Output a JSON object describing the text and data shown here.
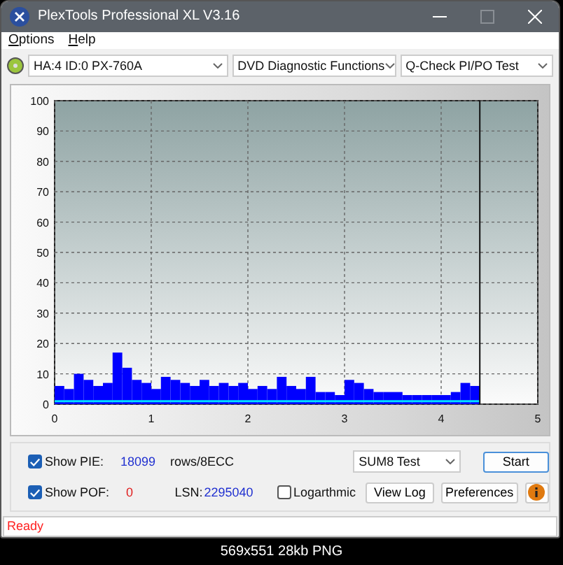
{
  "window": {
    "title": "PlexTools Professional XL V3.16"
  },
  "menu": [
    "Options",
    "Help"
  ],
  "toolbar": {
    "drive": "HA:4 ID:0  PX-760A",
    "function": "DVD Diagnostic Functions",
    "test": "Q-Check PI/PO Test"
  },
  "chart": {
    "chart_data": {
      "type": "bar",
      "xlim": [
        0,
        5
      ],
      "ylim": [
        0,
        100
      ],
      "xticks": [
        0,
        1,
        2,
        3,
        4,
        5
      ],
      "yticks": [
        0,
        10,
        20,
        30,
        40,
        50,
        60,
        70,
        80,
        90,
        100
      ],
      "x": [
        0.05,
        0.15,
        0.25,
        0.35,
        0.45,
        0.55,
        0.65,
        0.75,
        0.85,
        0.95,
        1.05,
        1.15,
        1.25,
        1.35,
        1.45,
        1.55,
        1.65,
        1.75,
        1.85,
        1.95,
        2.05,
        2.15,
        2.25,
        2.35,
        2.45,
        2.55,
        2.65,
        2.75,
        2.85,
        2.95,
        3.05,
        3.15,
        3.25,
        3.35,
        3.45,
        3.55,
        3.65,
        3.75,
        3.85,
        3.95,
        4.05,
        4.15,
        4.25,
        4.35
      ],
      "series": [
        {
          "color": "#0000ff",
          "values": [
            6,
            5,
            10,
            8,
            6,
            7,
            17,
            12,
            8,
            7,
            5,
            9,
            8,
            7,
            6,
            8,
            6,
            7,
            6,
            7,
            5,
            6,
            5,
            9,
            6,
            5,
            9,
            4,
            4,
            3,
            8,
            7,
            5,
            4,
            4,
            4,
            3,
            3,
            3,
            3,
            3,
            4,
            7,
            6
          ]
        }
      ],
      "grid": true,
      "ref_lines": [
        {
          "axis": "y",
          "value": 1,
          "color": "#00e0ff"
        },
        {
          "axis": "x",
          "value": 4.4,
          "color": "#111111"
        }
      ]
    }
  },
  "controls": {
    "show_pie": {
      "label": "Show PIE:",
      "checked": true,
      "value": "18099"
    },
    "unit": "rows/8ECC",
    "show_poe": {
      "label": "Show POF:",
      "checked": true,
      "value": "0"
    },
    "lsn": {
      "label": "LSN:",
      "value": "2295040"
    },
    "logarithmic": {
      "label": "Logarthmic",
      "checked": false
    },
    "mode": "SUM8 Test",
    "buttons": [
      "Start",
      "View Log",
      "Preferences"
    ]
  },
  "status_bar": "Ready",
  "caption": "569x551 28kb PNG"
}
